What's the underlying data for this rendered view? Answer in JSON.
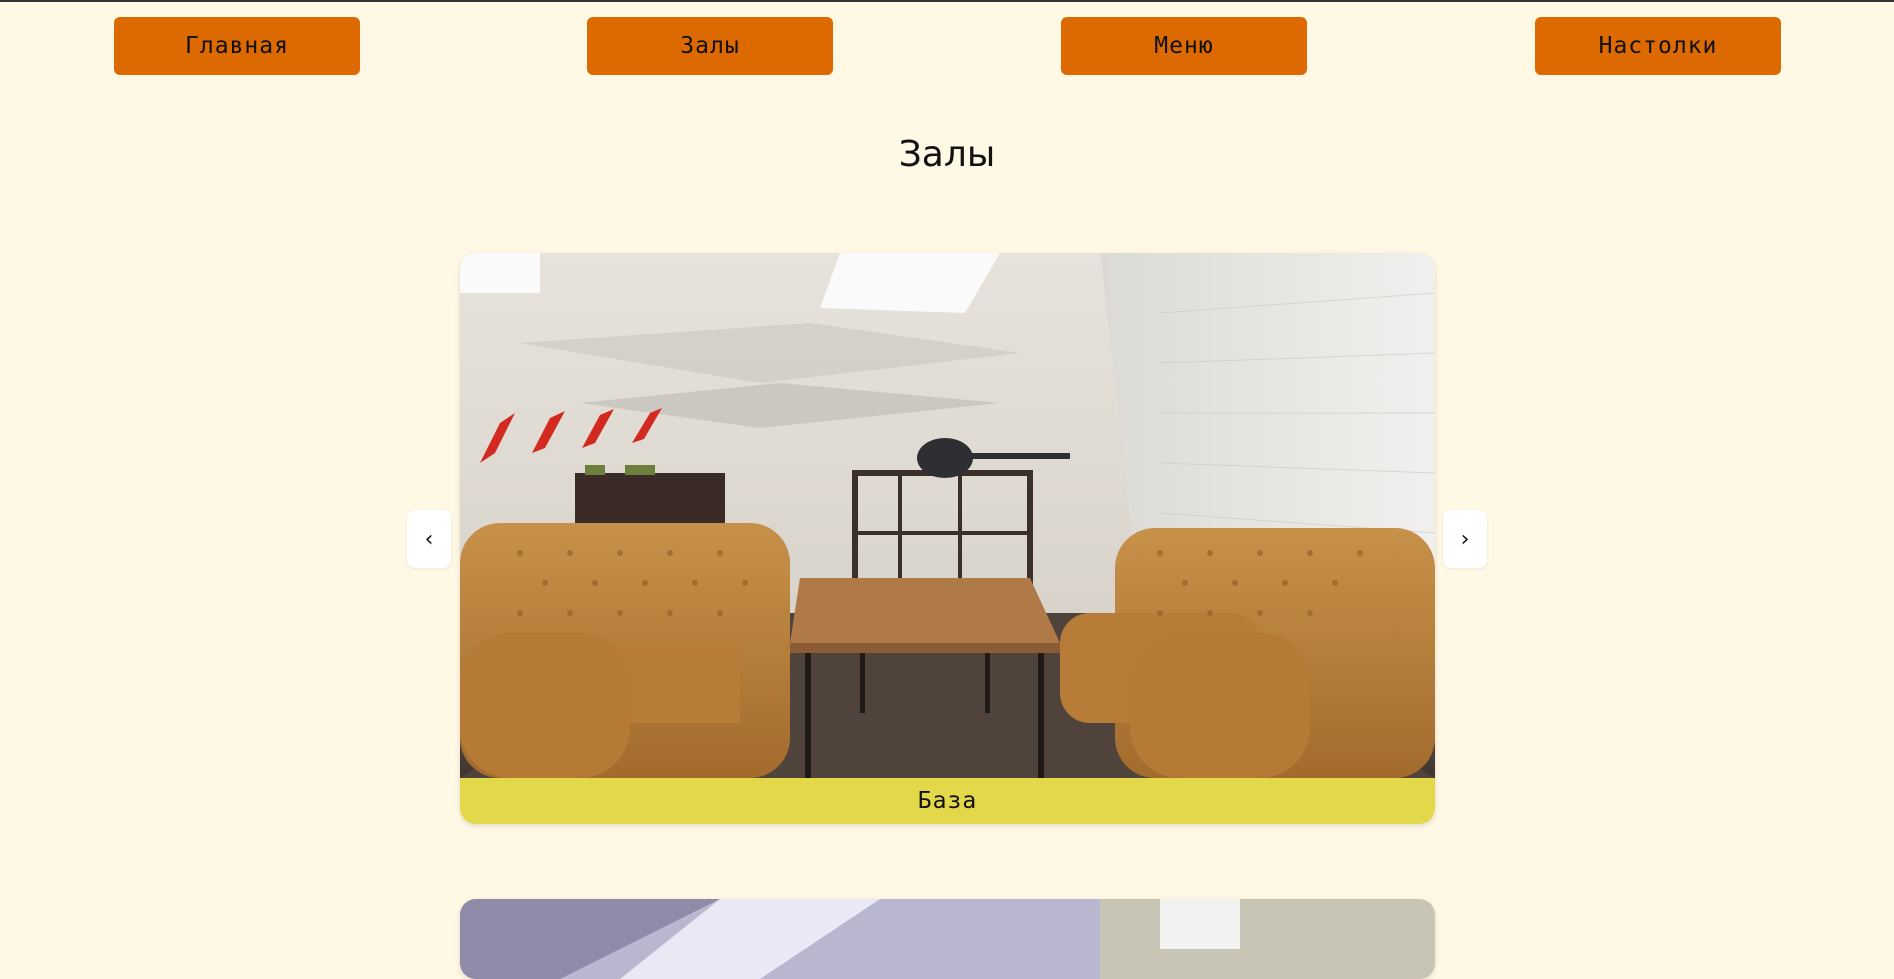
{
  "nav": {
    "items": [
      {
        "label": "Главная"
      },
      {
        "label": "Залы"
      },
      {
        "label": "Меню"
      },
      {
        "label": "Настолки"
      }
    ]
  },
  "page": {
    "title": "Залы"
  },
  "carousel": {
    "prev_label": "‹",
    "next_label": "›",
    "slides": [
      {
        "caption": "База"
      }
    ]
  },
  "colors": {
    "background": "#fef8e4",
    "nav_button": "#dd6a00",
    "caption_bar": "#e3d74a"
  }
}
